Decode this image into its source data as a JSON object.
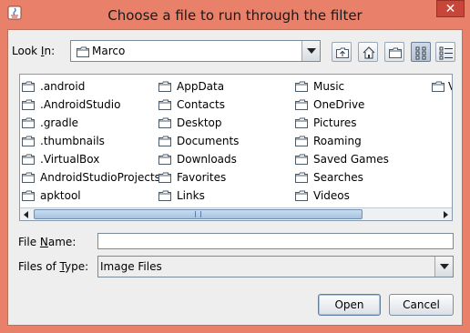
{
  "window": {
    "title": "Choose a file to run through the filter",
    "close_label": "✕"
  },
  "look_in": {
    "label_prefix": "Look ",
    "label_mnemonic": "I",
    "label_suffix": "n:",
    "value": "Marco"
  },
  "toolbar": {
    "buttons": [
      {
        "name": "up-one-level-button",
        "icon": "folder-up-icon"
      },
      {
        "name": "home-button",
        "icon": "home-icon"
      },
      {
        "name": "create-new-folder-button",
        "icon": "new-folder-icon"
      },
      {
        "name": "list-view-button",
        "icon": "list-view-icon",
        "selected": true
      },
      {
        "name": "details-view-button",
        "icon": "details-view-icon"
      }
    ]
  },
  "files": {
    "col1": [
      ".android",
      ".AndroidStudio",
      ".gradle",
      ".thumbnails",
      ".VirtualBox",
      "AndroidStudioProjects",
      "apktool"
    ],
    "col2": [
      "AppData",
      "Contacts",
      "Desktop",
      "Documents",
      "Downloads",
      "Favorites",
      "Links"
    ],
    "col3": [
      "Music",
      "OneDrive",
      "Pictures",
      "Roaming",
      "Saved Games",
      "Searches",
      "Videos"
    ],
    "col4_partial": "V"
  },
  "file_name": {
    "label_prefix": "File ",
    "label_mnemonic": "N",
    "label_suffix": "ame:",
    "value": ""
  },
  "file_type": {
    "label_prefix": "Files of ",
    "label_mnemonic": "T",
    "label_suffix": "ype:",
    "value": "Image Files"
  },
  "buttons": {
    "open": "Open",
    "cancel": "Cancel"
  },
  "colors": {
    "title_bar": "#e9806a",
    "dialog_bg": "#eeeeee",
    "folder_outline": "#4d5b69"
  }
}
